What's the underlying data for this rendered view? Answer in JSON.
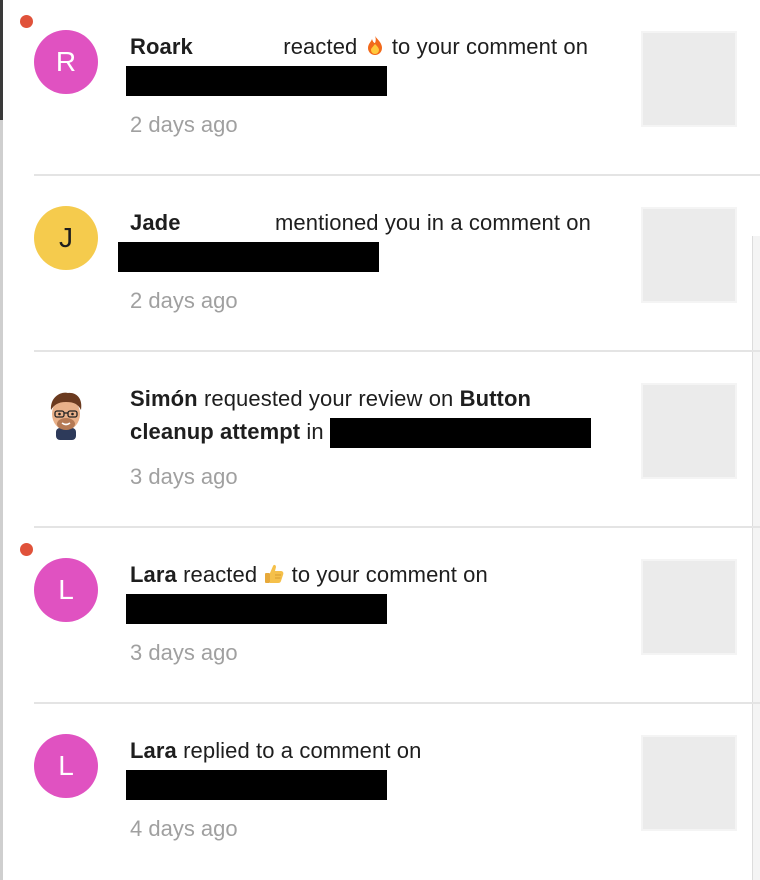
{
  "notifications": [
    {
      "actor": "Roark",
      "actor_color": "#e052c1",
      "initial": "R",
      "unread": true,
      "action_before": "reacted",
      "reaction_icon": "fire-emoji-icon",
      "action_after": "to your comment on",
      "time": "2 days ago"
    },
    {
      "actor": "Jade",
      "actor_color": "#f5cb4d",
      "initial": "J",
      "unread": false,
      "action": "mentioned you in a comment on",
      "time": "2 days ago"
    },
    {
      "actor": "Simón",
      "avatar_icon": "memoji-avatar-icon",
      "unread": false,
      "action": "requested your review on",
      "target_part1": "Button",
      "target_part2": "cleanup attempt",
      "connector": "in",
      "time": "3 days ago"
    },
    {
      "actor": "Lara",
      "actor_color": "#e052c1",
      "initial": "L",
      "unread": true,
      "action_before": "reacted",
      "reaction_icon": "thumbs-up-emoji-icon",
      "action_after": "to your comment on",
      "time": "3 days ago"
    },
    {
      "actor": "Lara",
      "actor_color": "#e052c1",
      "initial": "L",
      "unread": false,
      "action": "replied to a comment on",
      "time": "4 days ago"
    }
  ],
  "colors": {
    "unread_dot": "#e0523a",
    "timestamp": "#a0a0a0",
    "thumbnail": "#ebebeb",
    "divider": "#e4e4e4"
  }
}
